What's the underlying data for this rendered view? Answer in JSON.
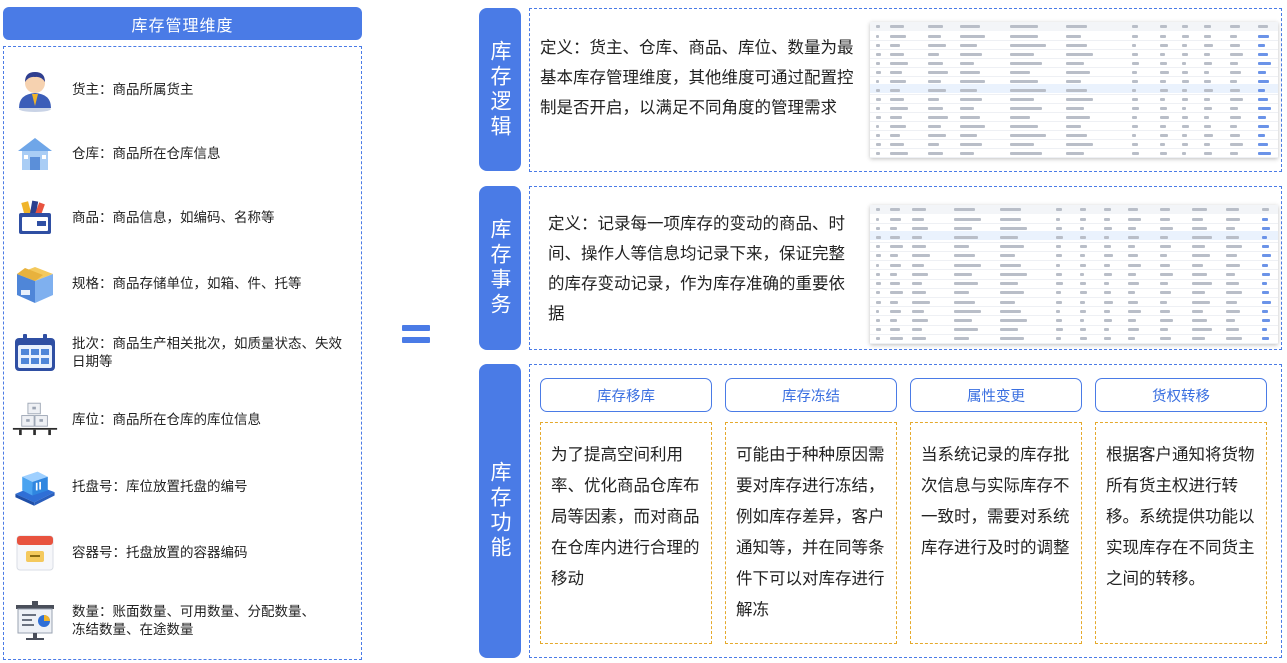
{
  "left": {
    "title": "库存管理维度",
    "items": [
      {
        "icon": "owner-icon",
        "text": "货主：商品所属货主"
      },
      {
        "icon": "warehouse-icon",
        "text": "仓库：商品所在仓库信息"
      },
      {
        "icon": "product-icon",
        "text": "商品：商品信息，如编码、名称等"
      },
      {
        "icon": "package-icon",
        "text": "规格：商品存储单位，如箱、件、托等"
      },
      {
        "icon": "calendar-icon",
        "text": "批次：商品生产相关批次，如质量状态、失效日期等"
      },
      {
        "icon": "location-icon",
        "text": "库位：商品所在仓库的库位信息"
      },
      {
        "icon": "pallet-icon",
        "text": "托盘号：库位放置托盘的编号"
      },
      {
        "icon": "container-icon",
        "text": "容器号：托盘放置的容器编码"
      },
      {
        "icon": "quantity-icon",
        "text": "数量：账面数量、可用数量、分配数量、冻结数量、在途数量"
      }
    ]
  },
  "sections": {
    "logic": {
      "tab_label": "库存逻辑",
      "definition": "定义：货主、仓库、商品、库位、数量为最基本库存管理维度，其他维度可通过配置控制是否开启，以满足不同角度的管理需求"
    },
    "transaction": {
      "tab_label": "库存事务",
      "definition": "定义：记录每一项库存的变动的商品、时间、操作人等信息均记录下来，保证完整的库存变动记录，作为库存准确的重要依据"
    },
    "functions": {
      "tab_label": "库存功能",
      "cards": [
        {
          "title": "库存移库",
          "body": "为了提高空间利用率、优化商品仓库布局等因素，而对商品在仓库内进行合理的移动"
        },
        {
          "title": "库存冻结",
          "body": "可能由于种种原因需要对库存进行冻结，例如库存差异，客户通知等，并在同等条件下可以对库存进行解冻"
        },
        {
          "title": "属性变更",
          "body": "当系统记录的库存批次信息与实际库存不一致时，需要对系统库存进行及时的调整"
        },
        {
          "title": "货权转移",
          "body": "根据客户通知将货物所有货主权进行转移。系统提供功能以实现库存在不同货主之间的转移。"
        }
      ]
    }
  },
  "colors": {
    "accent": "#4A7BE6",
    "card_border": "#E5A92C"
  }
}
